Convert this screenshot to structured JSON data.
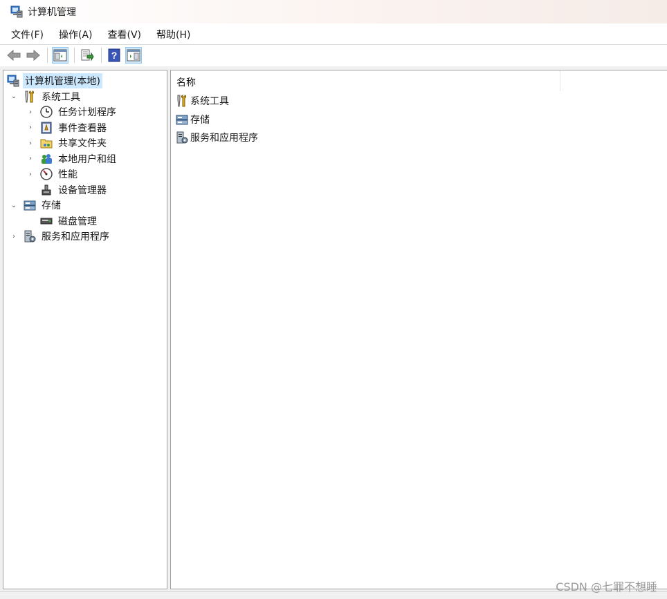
{
  "window": {
    "title": "计算机管理"
  },
  "menu": [
    "文件(F)",
    "操作(A)",
    "查看(V)",
    "帮助(H)"
  ],
  "tree": [
    {
      "label": "计算机管理(本地)",
      "icon": "computer-management-icon",
      "level": 0,
      "expander": "",
      "selected": true
    },
    {
      "label": "系统工具",
      "icon": "tools-icon",
      "level": 1,
      "expander": "⌄",
      "selected": false
    },
    {
      "label": "任务计划程序",
      "icon": "clock-icon",
      "level": 2,
      "expander": "›",
      "selected": false
    },
    {
      "label": "事件查看器",
      "icon": "event-viewer-icon",
      "level": 2,
      "expander": "›",
      "selected": false
    },
    {
      "label": "共享文件夹",
      "icon": "shared-folder-icon",
      "level": 2,
      "expander": "›",
      "selected": false
    },
    {
      "label": "本地用户和组",
      "icon": "users-icon",
      "level": 2,
      "expander": "›",
      "selected": false
    },
    {
      "label": "性能",
      "icon": "performance-icon",
      "level": 2,
      "expander": "›",
      "selected": false
    },
    {
      "label": "设备管理器",
      "icon": "device-manager-icon",
      "level": 2,
      "expander": "",
      "selected": false
    },
    {
      "label": "存储",
      "icon": "storage-icon",
      "level": 1,
      "expander": "⌄",
      "selected": false
    },
    {
      "label": "磁盘管理",
      "icon": "disk-icon",
      "level": 2,
      "expander": "",
      "selected": false
    },
    {
      "label": "服务和应用程序",
      "icon": "services-icon",
      "level": 1,
      "expander": "›",
      "selected": false
    }
  ],
  "list": {
    "column": "名称",
    "items": [
      {
        "label": "系统工具",
        "icon": "tools-icon"
      },
      {
        "label": "存储",
        "icon": "storage-icon"
      },
      {
        "label": "服务和应用程序",
        "icon": "services-icon"
      }
    ]
  },
  "watermark": "CSDN @七罪不想睡",
  "colors": {
    "selection": "#cce8ff",
    "border": "#a0a0a0",
    "toolbar_active": "#cde6f7"
  }
}
